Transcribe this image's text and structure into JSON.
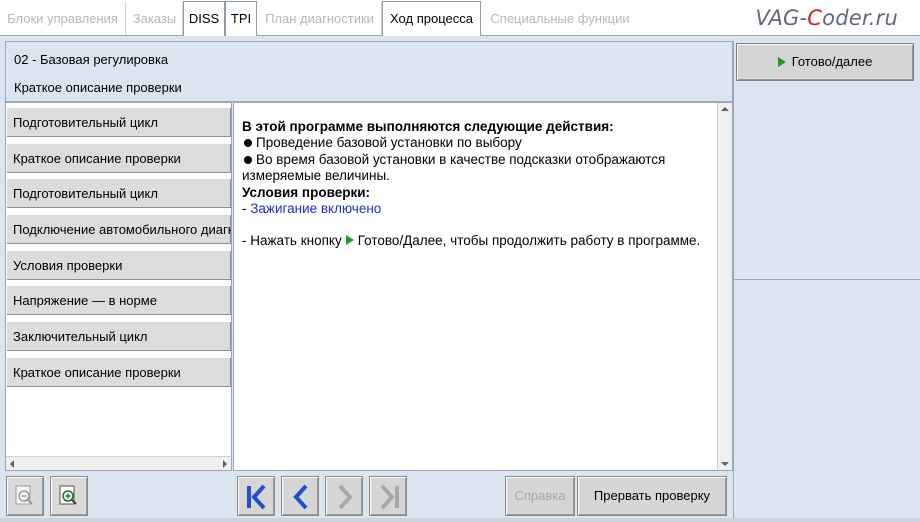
{
  "tabs": [
    {
      "label": "Блоки управления",
      "active": false
    },
    {
      "label": "Заказы",
      "active": false
    },
    {
      "label": "DISS",
      "active": true
    },
    {
      "label": "TPI",
      "active": true
    },
    {
      "label": "План диагностики",
      "active": false
    },
    {
      "label": "Ход процесса",
      "active": true
    },
    {
      "label": "Специальные функции",
      "active": false
    }
  ],
  "logo": {
    "part1": "VAG-",
    "part2": "C",
    "part3": "oder.ru"
  },
  "header": {
    "title": "02 - Базовая регулировка",
    "subtitle": "Краткое описание проверки"
  },
  "right_panel": {
    "ready_label": "Готово/далее"
  },
  "steps": [
    "Подготовительный цикл",
    "Краткое описание проверки",
    "Подготовительный цикл",
    "Подключение автомобильного диагностического тестера",
    "Условия проверки",
    "Напряжение — в норме",
    "Заключительный цикл",
    "Краткое описание проверки"
  ],
  "content": {
    "heading": "В этой программе выполняются следующие действия:",
    "bullet1": "Проведение базовой установки по выбору",
    "bullet2": "Во время базовой установки в качестве подсказки отображаются измеряемые величины.",
    "conditions_heading": "Условия проверки:",
    "condition_prefix": "- ",
    "condition1": "Зажигание включено",
    "instruction_before": "- Нажать кнопку",
    "instruction_after": "Готово/Далее, чтобы продолжить работу в программе."
  },
  "bottom": {
    "help_label": "Справка",
    "abort_label": "Прервать проверку"
  },
  "colors": {
    "background": "#dbe5f0",
    "accent_blue": "#1a2fd0",
    "play_green": "#1f9a2a",
    "logo_red": "#d42222"
  }
}
